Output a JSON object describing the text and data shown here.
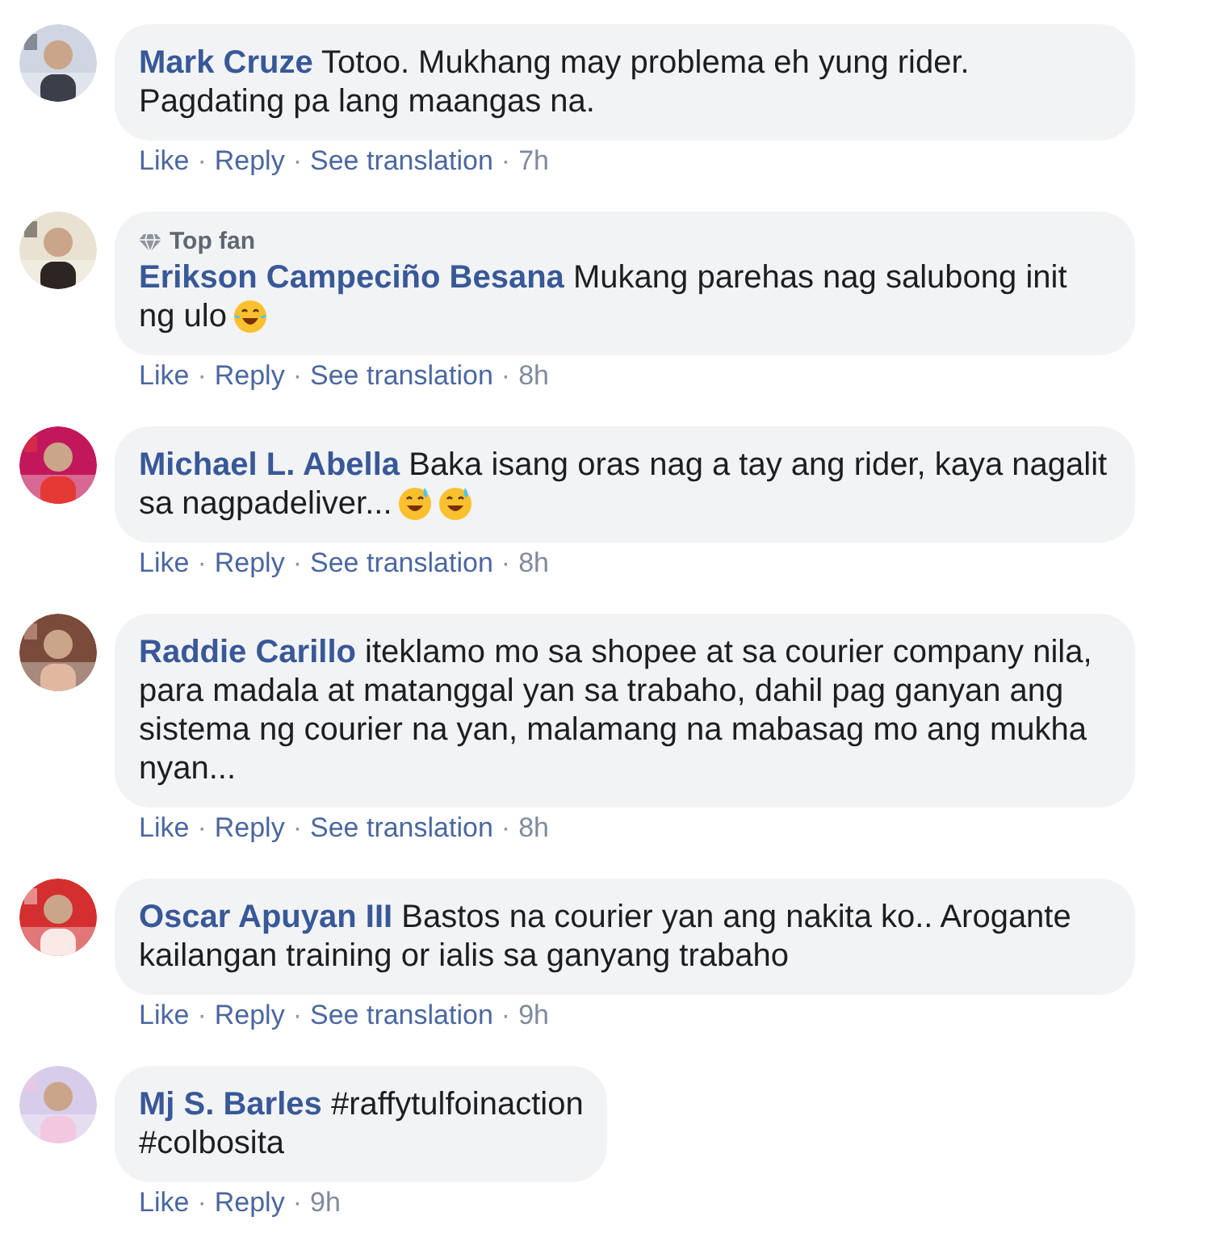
{
  "comments": [
    {
      "author": "Mark Cruze",
      "text": "Totoo. Mukhang may problema eh yung rider. Pagdating pa lang maangas na.",
      "actions": [
        {
          "label": "Like",
          "separator": "·"
        },
        {
          "label": "Reply",
          "separator": "·"
        },
        {
          "label": "See translation",
          "separator": "·"
        }
      ],
      "time": "7h"
    },
    {
      "author": "Erikson Campeciño Besana",
      "text": "Mukang parehas nag salubong init ng ulo",
      "badge": "Top fan",
      "emojis": [
        {
          "kind": "tears-of-joy"
        }
      ],
      "actions": [
        {
          "label": "Like",
          "separator": "·"
        },
        {
          "label": "Reply",
          "separator": "·"
        },
        {
          "label": "See translation",
          "separator": "·"
        }
      ],
      "time": "8h"
    },
    {
      "author": "Michael L. Abella",
      "text": "Baka isang oras nag a tay ang rider, kaya nagalit sa nagpadeliver...",
      "emojis": [
        {
          "kind": "sweat-smile"
        },
        {
          "kind": "sweat-smile"
        }
      ],
      "actions": [
        {
          "label": "Like",
          "separator": "·"
        },
        {
          "label": "Reply",
          "separator": "·"
        },
        {
          "label": "See translation",
          "separator": "·"
        }
      ],
      "time": "8h"
    },
    {
      "author": "Raddie Carillo",
      "text": "iteklamo mo sa shopee at sa courier company nila, para madala at matanggal yan sa trabaho, dahil pag ganyan ang sistema ng courier na yan, malamang na mabasag mo ang mukha nyan...",
      "actions": [
        {
          "label": "Like",
          "separator": "·"
        },
        {
          "label": "Reply",
          "separator": "·"
        },
        {
          "label": "See translation",
          "separator": "·"
        }
      ],
      "time": "8h"
    },
    {
      "author": "Oscar Apuyan III",
      "text": "Bastos na courier yan ang nakita ko.. Arogante kailangan training or ialis sa ganyang trabaho",
      "actions": [
        {
          "label": "Like",
          "separator": "·"
        },
        {
          "label": "Reply",
          "separator": "·"
        },
        {
          "label": "See translation",
          "separator": "·"
        }
      ],
      "time": "9h"
    },
    {
      "author": "Mj S. Barles",
      "text": "#raffytulfoinaction\n#colbosita",
      "actions": [
        {
          "label": "Like",
          "separator": "·"
        },
        {
          "label": "Reply",
          "separator": "·"
        }
      ],
      "time": "9h"
    }
  ]
}
